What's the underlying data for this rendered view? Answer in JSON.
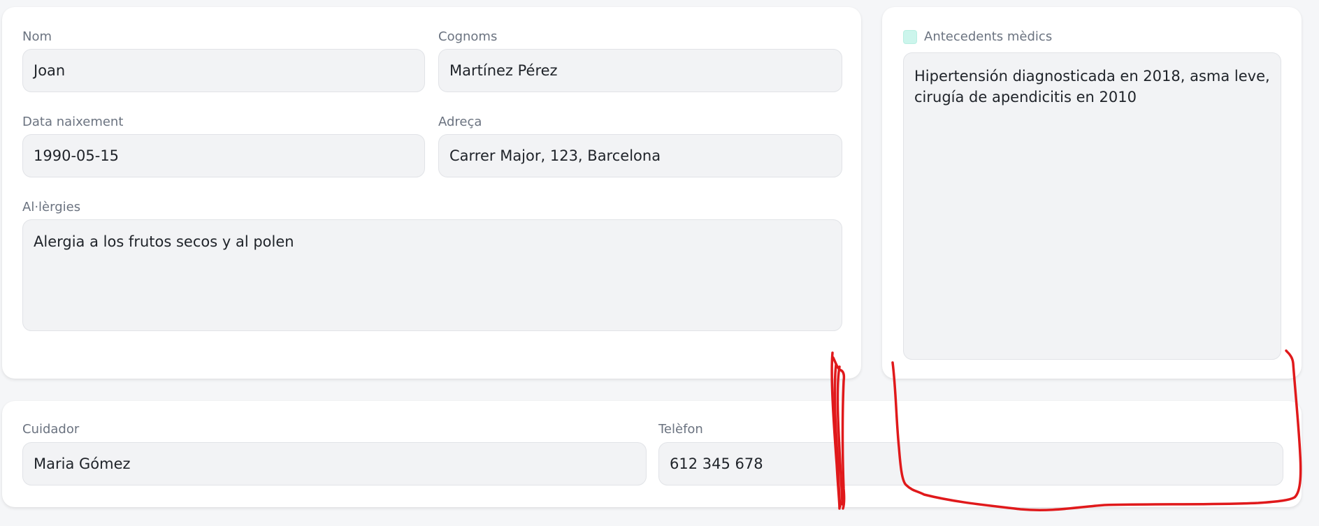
{
  "patient": {
    "first_name": {
      "label": "Nom",
      "value": "Joan"
    },
    "last_name": {
      "label": "Cognoms",
      "value": "Martínez Pérez"
    },
    "birth_date": {
      "label": "Data naixement",
      "value": "1990-05-15"
    },
    "address": {
      "label": "Adreça",
      "value": "Carrer Major, 123, Barcelona"
    },
    "allergies": {
      "label": "Al·lèrgies",
      "value": "Alergia a los frutos secos y al polen"
    }
  },
  "history": {
    "label": "Antecedents mèdics",
    "checked": false,
    "checkbox_color": "#ccf5ec",
    "line1": "Hipertensión diagnosticada en 2018, asma leve,",
    "line2": "cirugía de apendicitis en 2010"
  },
  "carer": {
    "name": {
      "label": "Cuidador",
      "value": "Maria Gómez"
    },
    "phone": {
      "label": "Telèfon",
      "value": "612 345 678"
    }
  },
  "annotation": {
    "color": "#e0191b"
  }
}
